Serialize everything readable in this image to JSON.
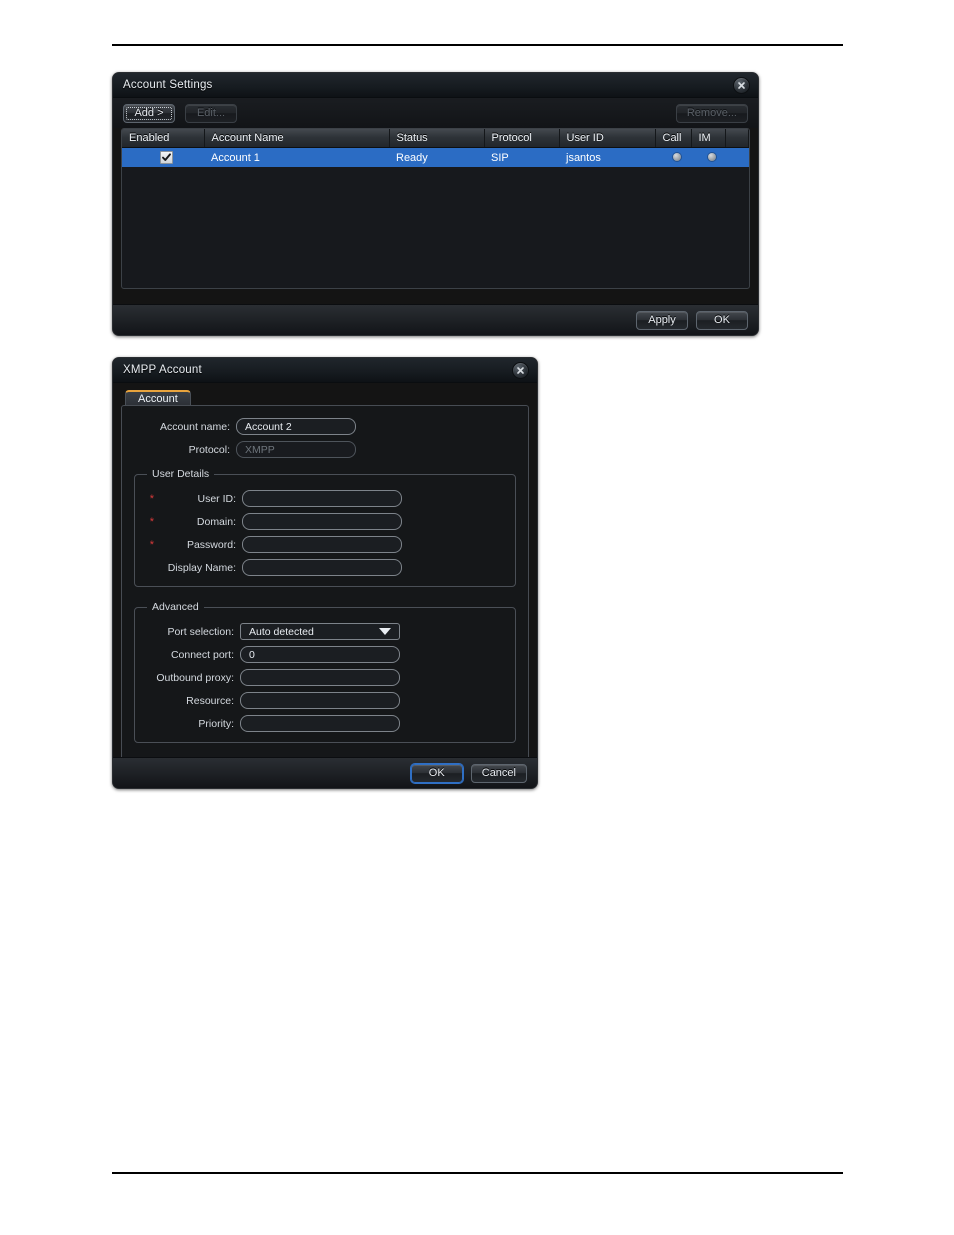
{
  "account_settings": {
    "title": "Account Settings",
    "close_icon": "close-icon",
    "toolbar": {
      "add_label": "Add >",
      "edit_label": "Edit...",
      "remove_label": "Remove..."
    },
    "table": {
      "columns": [
        "Enabled",
        "Account Name",
        "Status",
        "Protocol",
        "User ID",
        "Call",
        "IM",
        ""
      ],
      "rows": [
        {
          "enabled": true,
          "account_name": "Account 1",
          "status": "Ready",
          "protocol": "SIP",
          "user_id": "jsantos",
          "call": "indicator-dot",
          "im": "indicator-dot",
          "selected": true
        }
      ]
    },
    "footer": {
      "apply_label": "Apply",
      "ok_label": "OK"
    },
    "colors": {
      "selection": "#2b6cc4"
    }
  },
  "xmpp_account": {
    "title": "XMPP Account",
    "close_icon": "close-icon",
    "tabs": [
      {
        "label": "Account",
        "active": true
      }
    ],
    "fields": {
      "account_name_label": "Account name:",
      "account_name_value": "Account 2",
      "protocol_label": "Protocol:",
      "protocol_value": "XMPP",
      "protocol_disabled": true
    },
    "user_details": {
      "legend": "User Details",
      "rows": [
        {
          "label": "User ID:",
          "value": "",
          "required": true
        },
        {
          "label": "Domain:",
          "value": "",
          "required": true
        },
        {
          "label": "Password:",
          "value": "",
          "required": true
        },
        {
          "label": "Display Name:",
          "value": "",
          "required": false
        }
      ]
    },
    "advanced": {
      "legend": "Advanced",
      "port_selection_label": "Port selection:",
      "port_selection_value": "Auto detected",
      "rows": [
        {
          "label": "Connect port:",
          "value": "0"
        },
        {
          "label": "Outbound proxy:",
          "value": ""
        },
        {
          "label": "Resource:",
          "value": ""
        },
        {
          "label": "Priority:",
          "value": ""
        }
      ]
    },
    "footer": {
      "ok_label": "OK",
      "cancel_label": "Cancel"
    },
    "colors": {
      "tab_accent": "#e8a33d",
      "required_star": "#d93a3a"
    }
  }
}
